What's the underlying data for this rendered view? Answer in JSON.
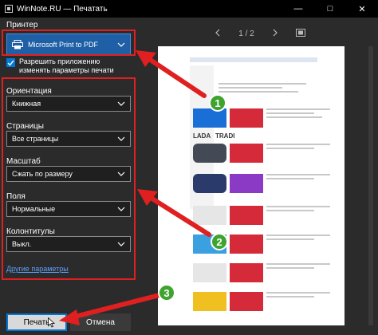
{
  "window": {
    "title": "WinNote.RU — Печатать",
    "minimize": "—",
    "maximize": "□",
    "close": "✕"
  },
  "printer": {
    "label": "Принтер",
    "selected": "Microsoft Print to PDF",
    "allow_app_label": "Разрешить приложению изменять параметры печати"
  },
  "settings": {
    "orientation_label": "Ориентация",
    "orientation_value": "Книжная",
    "pages_label": "Страницы",
    "pages_value": "Все страницы",
    "scale_label": "Масштаб",
    "scale_value": "Сжать по размеру",
    "margins_label": "Поля",
    "margins_value": "Нормальные",
    "headers_label": "Колонтитулы",
    "headers_value": "Выкл.",
    "more_settings": "Другие параметры"
  },
  "buttons": {
    "print": "Печать",
    "cancel": "Отмена"
  },
  "preview": {
    "page_current": "1",
    "page_sep": "/",
    "page_total": "2",
    "ad_text_lada": "LADA",
    "ad_text_trade": "TRADI"
  },
  "markers": {
    "one": "1",
    "two": "2",
    "three": "3"
  },
  "colors": {
    "accent": "#1e5fa6",
    "highlight_red": "#e02020",
    "marker_green": "#3fa32f",
    "link": "#5aa0ff"
  }
}
